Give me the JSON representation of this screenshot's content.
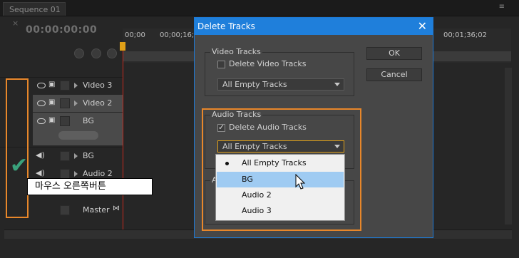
{
  "tab": {
    "title": "Sequence 01",
    "menu": "≡"
  },
  "timecode": "00:00:00:00",
  "ruler": {
    "ticks": [
      "00;00",
      "00;00;16;",
      "00;01;36;02"
    ]
  },
  "tracks": [
    {
      "name": "Video 3",
      "type": "video"
    },
    {
      "name": "Video 2",
      "type": "video"
    },
    {
      "name": "BG",
      "type": "video"
    },
    {
      "name": "BG",
      "type": "audio"
    },
    {
      "name": "Audio 2",
      "type": "audio"
    },
    {
      "name": "Master",
      "type": "master"
    }
  ],
  "dialog": {
    "title": "Delete Tracks",
    "close": "✕",
    "video_group": {
      "label": "Video Tracks",
      "checkbox_label": "Delete Video Tracks",
      "checked": false,
      "select_value": "All Empty Tracks"
    },
    "audio_group": {
      "label": "Audio Tracks",
      "checkbox_label": "Delete Audio Tracks",
      "checked": true,
      "select_value": "All Empty Tracks"
    },
    "third_group_label": "A",
    "ok": "OK",
    "cancel": "Cancel"
  },
  "dropdown": {
    "options": [
      "All Empty Tracks",
      "BG",
      "Audio 2",
      "Audio 3"
    ],
    "checked_index": 0,
    "highlighted_index": 1
  },
  "annotation": "마우스 오른쪽버튼",
  "colors": {
    "accent": "#1f7fdb",
    "highlight": "#e8872a",
    "playhead": "#c62a1e",
    "selection": "#9fcbf2"
  }
}
